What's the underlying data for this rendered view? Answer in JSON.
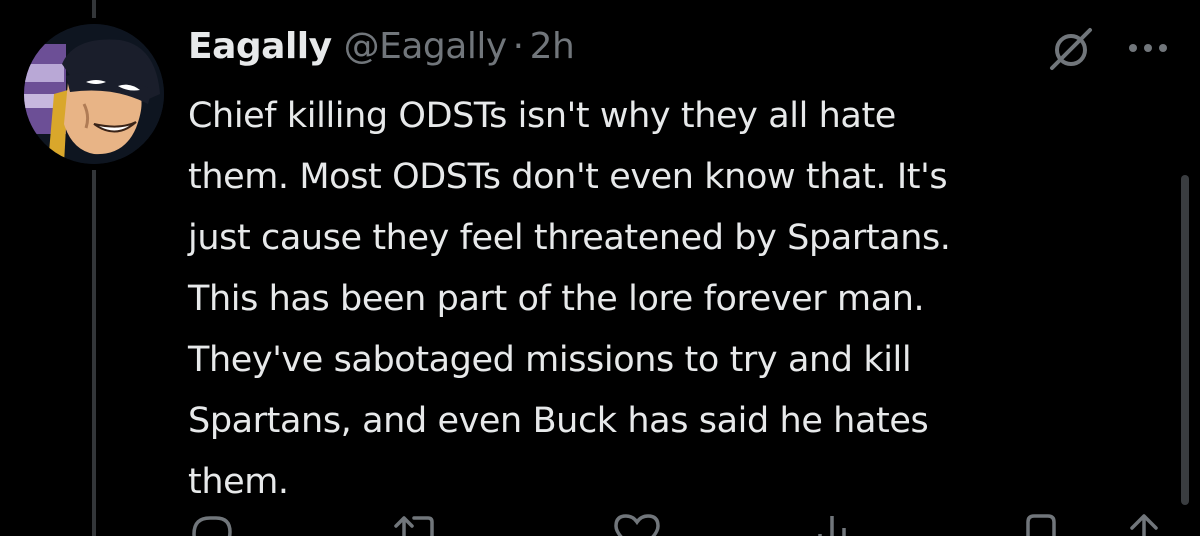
{
  "tweet": {
    "display_name": "Eagally",
    "handle": "@Eagally",
    "separator": "·",
    "time": "2h",
    "text_lines": [
      "Chief killing ODSTs isn't why they all hate",
      "them. Most ODSTs don't even know that. It's",
      "just cause they feel threatened by Spartans.",
      "This has been part of the lore forever man.",
      "They've sabotaged missions to try and kill",
      "Spartans, and even Buck has said he hates",
      "them."
    ]
  },
  "icons": {
    "grok": "grok-icon",
    "more": "more-icon",
    "reply": "reply-icon",
    "retweet": "retweet-icon",
    "like": "heart-icon",
    "views": "views-icon",
    "bookmark": "bookmark-icon",
    "share": "share-icon"
  },
  "colors": {
    "background": "#000000",
    "text_primary": "#e7e9ea",
    "text_secondary": "#71767b",
    "thread_line": "#333639"
  }
}
